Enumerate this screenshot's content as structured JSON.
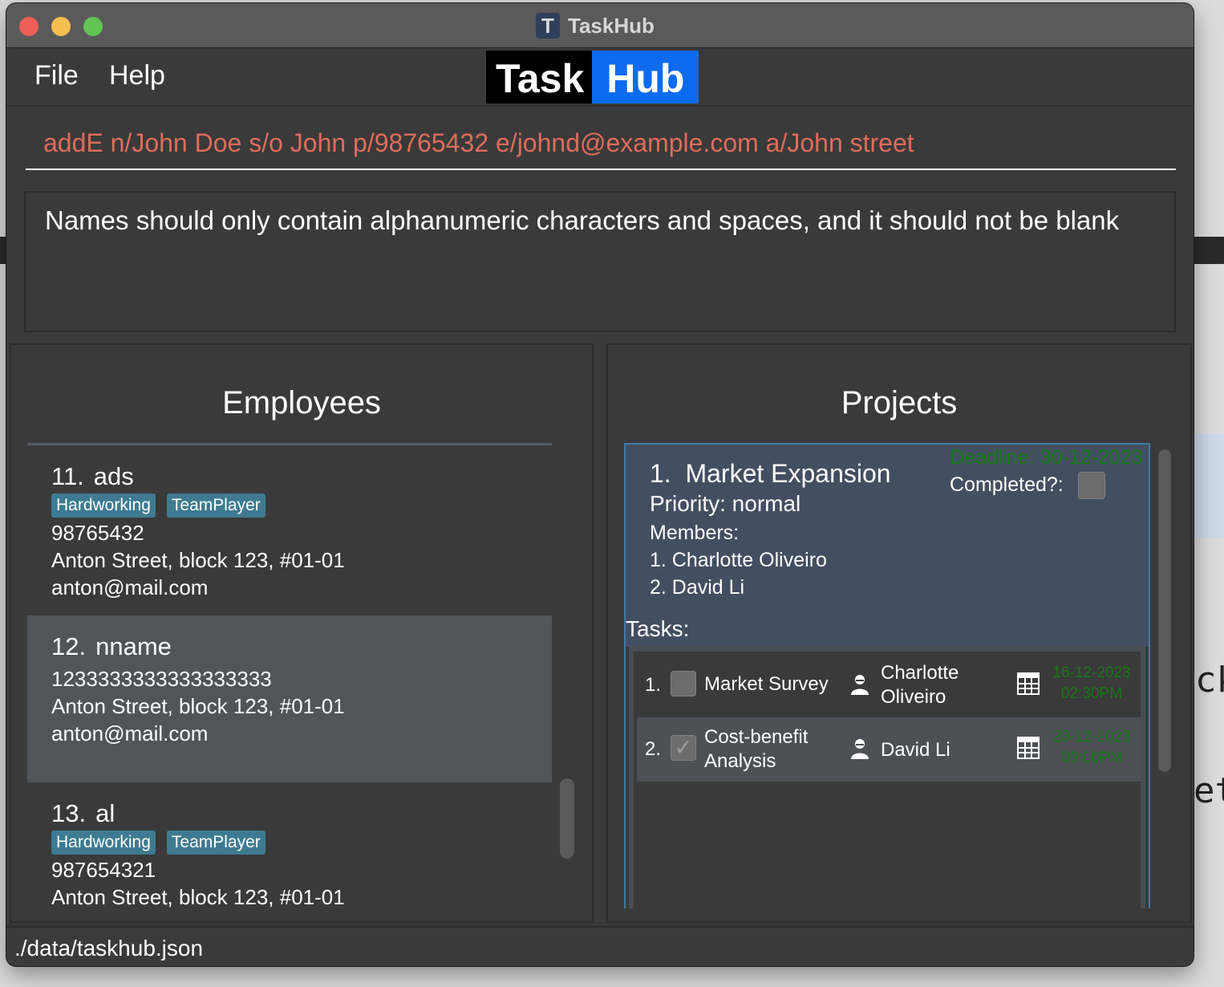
{
  "window": {
    "title": "TaskHub",
    "app_icon_letter": "T"
  },
  "menu": {
    "file": "File",
    "help": "Help"
  },
  "logo": {
    "part1": "Task",
    "part2": "Hub"
  },
  "command": {
    "value": "addE n/John Doe s/o John p/98765432 e/johnd@example.com a/John street"
  },
  "result": {
    "message": "Names should only contain alphanumeric characters and spaces, and it should not be blank"
  },
  "employees": {
    "title": "Employees",
    "items": [
      {
        "index": "11.",
        "name": "ads",
        "tags": [
          "Hardworking",
          "TeamPlayer"
        ],
        "phone": "98765432",
        "address": "Anton Street, block 123, #01-01",
        "email": "anton@mail.com"
      },
      {
        "index": "12.",
        "name": "nname",
        "tags": [],
        "phone": "1233333333333333333",
        "address": "Anton Street, block 123, #01-01",
        "email": "anton@mail.com"
      },
      {
        "index": "13.",
        "name": "al",
        "tags": [
          "Hardworking",
          "TeamPlayer"
        ],
        "phone": "987654321",
        "address": "Anton Street, block 123, #01-01"
      }
    ]
  },
  "projects": {
    "title": "Projects",
    "items": [
      {
        "index": "1.",
        "name": "Market Expansion",
        "deadline": "Deadline: 30-12-2023",
        "completed_label": "Completed?:",
        "priority": "Priority: normal",
        "members_label": "Members:",
        "members": [
          "1. Charlotte Oliveiro",
          "2. David Li"
        ],
        "tasks_label": "Tasks:",
        "tasks": [
          {
            "index": "1.",
            "name": "Market Survey",
            "done": false,
            "assignee_line1": "Charlotte",
            "assignee_line2": "Oliveiro",
            "due_line1": "16-12-2023",
            "due_line2": "02:30PM"
          },
          {
            "index": "2.",
            "name_line1": "Cost-benefit",
            "name_line2": "Analysis",
            "done": true,
            "check_glyph": "✓",
            "assignee": "David Li",
            "due_line1": "28-12-2023",
            "due_line2": "06:00PM"
          }
        ]
      }
    ]
  },
  "status": {
    "file_path": "./data/taskhub.json"
  },
  "colors": {
    "command_text": "#e06c5a",
    "deadline_text": "#157a15",
    "tag_bg": "#3e7b91",
    "logo_hub_bg": "#0d6bf2",
    "selected_project_bg": "#434f60"
  }
}
